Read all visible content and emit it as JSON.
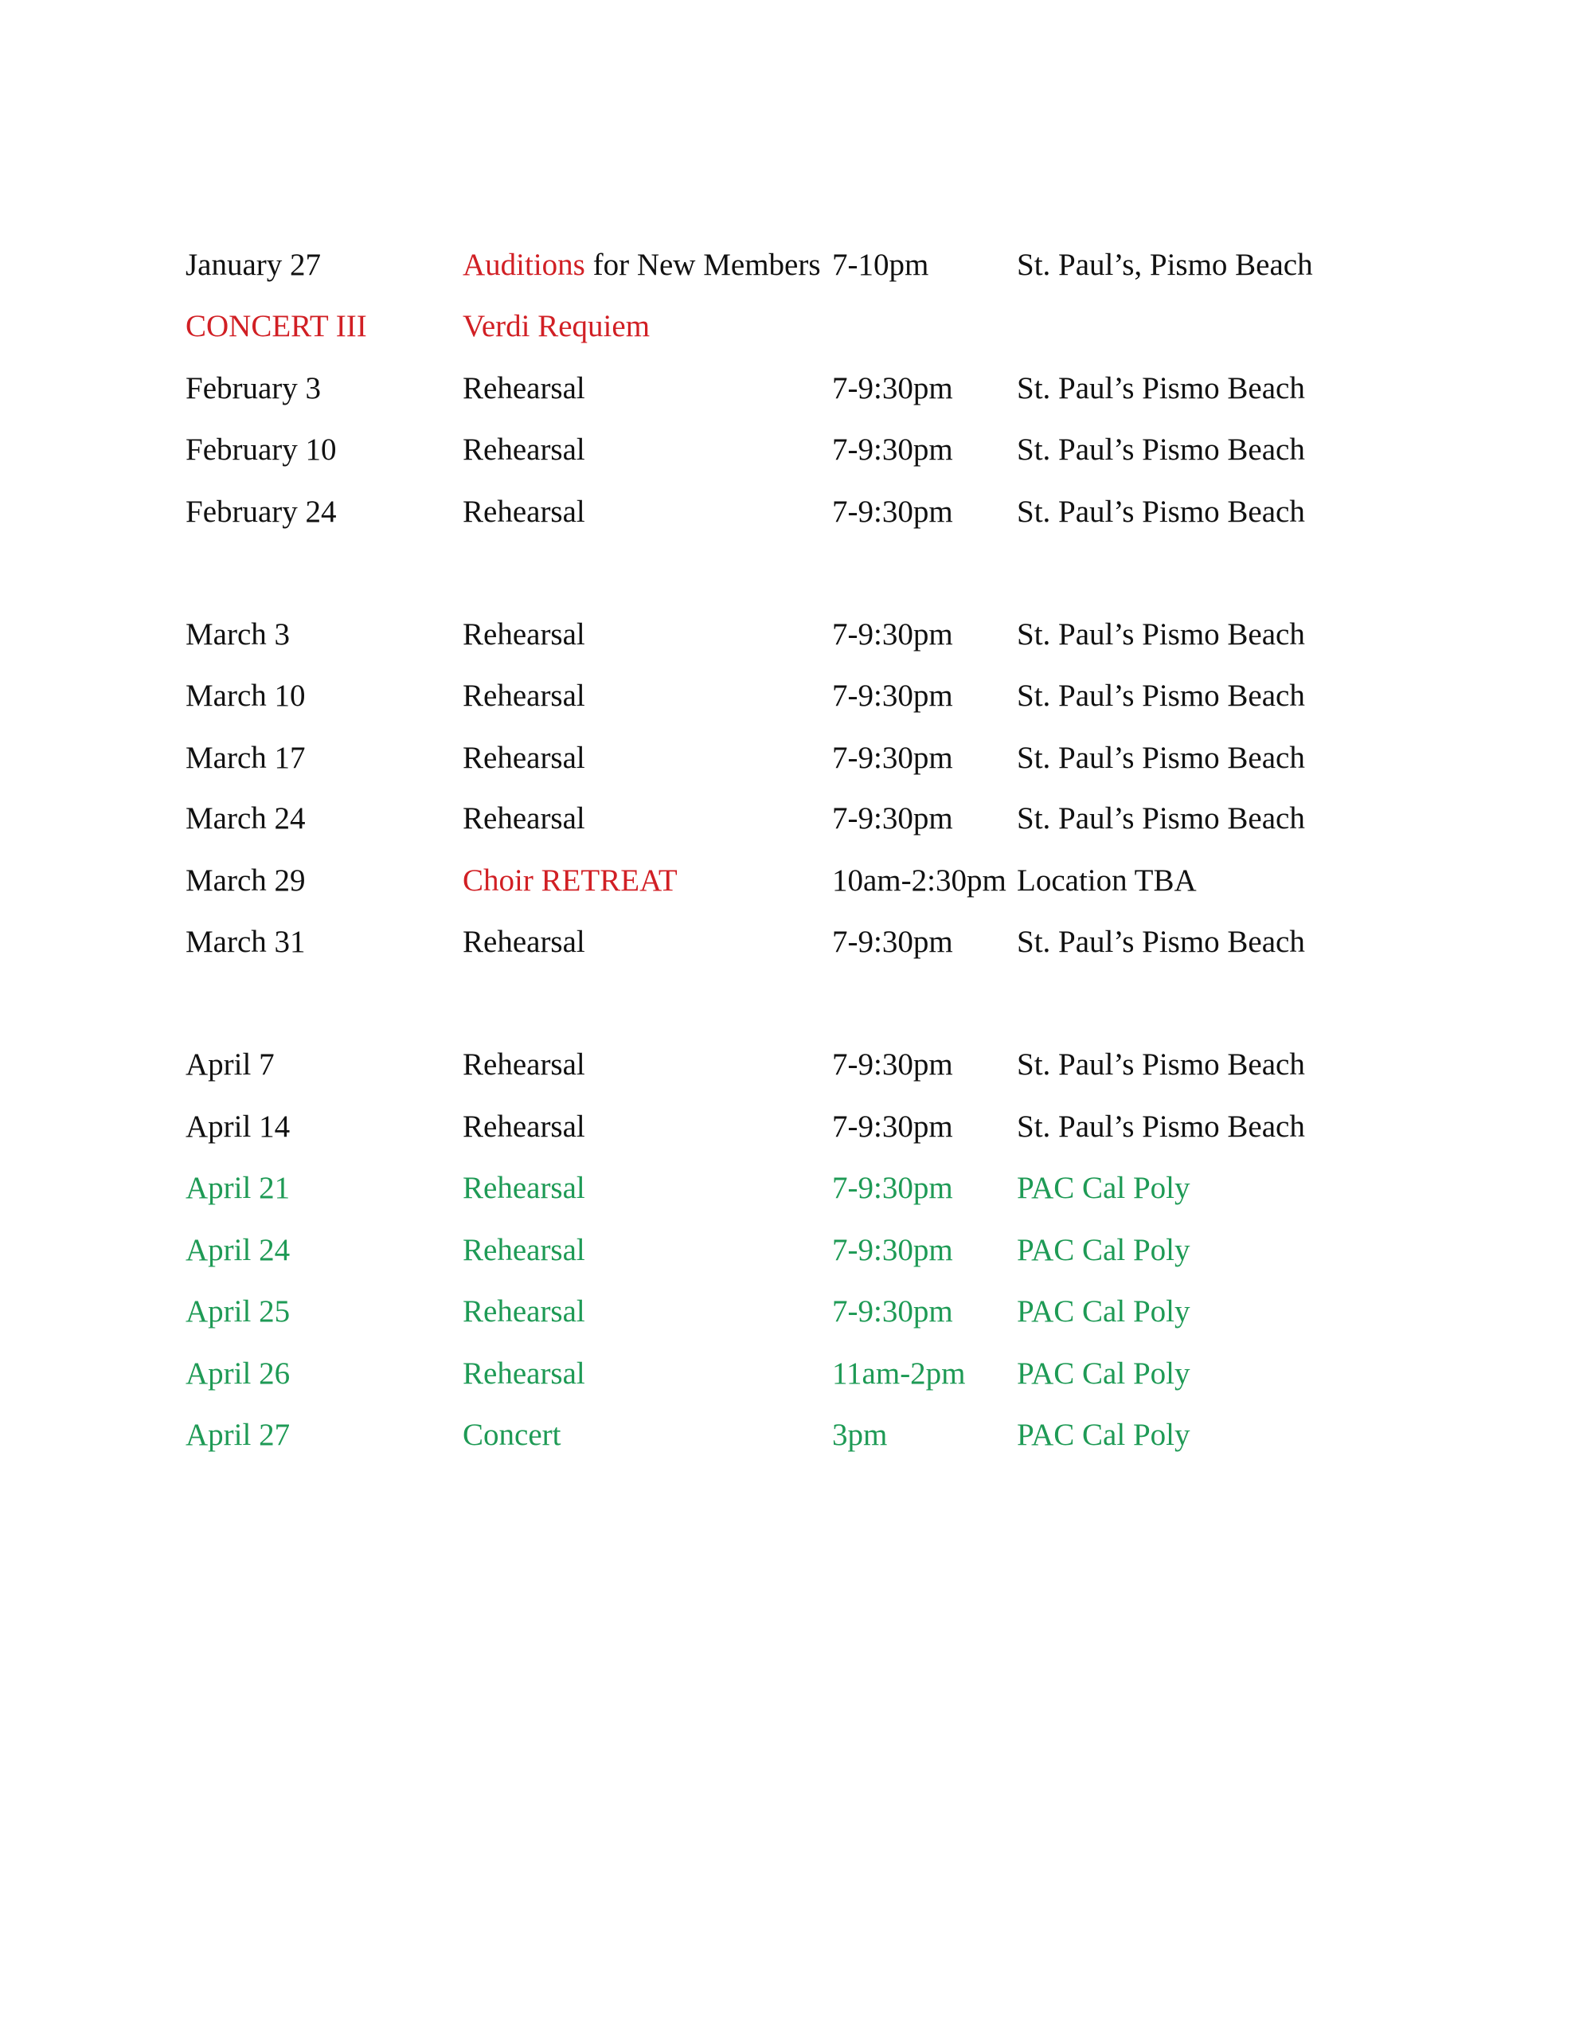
{
  "colors": {
    "black": "#111111",
    "red": "#d11f24",
    "green": "#1e9a55"
  },
  "schedule": {
    "rows": [
      {
        "date": "January 27",
        "event_highlight": "Auditions",
        "event": " for New Members",
        "time": "7-10pm",
        "location": "St. Paul’s, Pismo Beach",
        "style": "audition"
      },
      {
        "date": "CONCERT III",
        "event": "Verdi Requiem",
        "time": "",
        "location": "",
        "style": "red"
      },
      {
        "date": "February 3",
        "event": "Rehearsal",
        "time": "7-9:30pm",
        "location": "St. Paul’s Pismo Beach",
        "style": "black"
      },
      {
        "date": "February 10",
        "event": "Rehearsal",
        "time": "7-9:30pm",
        "location": "St. Paul’s Pismo Beach",
        "style": "black"
      },
      {
        "date": "February 24",
        "event": "Rehearsal",
        "time": "7-9:30pm",
        "location": "St. Paul’s Pismo Beach",
        "style": "black"
      },
      {
        "date": "March 3",
        "event": "Rehearsal",
        "time": "7-9:30pm",
        "location": "St. Paul’s Pismo Beach",
        "style": "black"
      },
      {
        "date": "March 10",
        "event": "Rehearsal",
        "time": "7-9:30pm",
        "location": "St. Paul’s Pismo Beach",
        "style": "black"
      },
      {
        "date": "March 17",
        "event": "Rehearsal",
        "time": "7-9:30pm",
        "location": "St. Paul’s Pismo Beach",
        "style": "black"
      },
      {
        "date": "March 24",
        "event": "Rehearsal",
        "time": "7-9:30pm",
        "location": "St. Paul’s Pismo Beach",
        "style": "black"
      },
      {
        "date": "March 29",
        "event": "Choir RETREAT",
        "time": "10am-2:30pm",
        "location": "Location TBA",
        "style": "retreat"
      },
      {
        "date": "March 31",
        "event": "Rehearsal",
        "time": "7-9:30pm",
        "location": "St. Paul’s Pismo Beach",
        "style": "black"
      },
      {
        "date": "April 7",
        "event": "Rehearsal",
        "time": "7-9:30pm",
        "location": "St. Paul’s Pismo Beach",
        "style": "black"
      },
      {
        "date": "April 14",
        "event": "Rehearsal",
        "time": "7-9:30pm",
        "location": "St. Paul’s Pismo Beach",
        "style": "black"
      },
      {
        "date": "April 21",
        "event": "Rehearsal",
        "time": "7-9:30pm",
        "location": "PAC Cal Poly",
        "style": "green"
      },
      {
        "date": "April 24",
        "event": "Rehearsal",
        "time": "7-9:30pm",
        "location": "PAC Cal Poly",
        "style": "green"
      },
      {
        "date": "April 25",
        "event": "Rehearsal",
        "time": "7-9:30pm",
        "location": "PAC Cal Poly",
        "style": "green"
      },
      {
        "date": "April 26",
        "event": "Rehearsal",
        "time": "11am-2pm",
        "location": "PAC Cal Poly",
        "style": "green"
      },
      {
        "date": "April 27",
        "event": "Concert",
        "time": "3pm",
        "location": "PAC Cal Poly",
        "style": "green"
      }
    ]
  }
}
